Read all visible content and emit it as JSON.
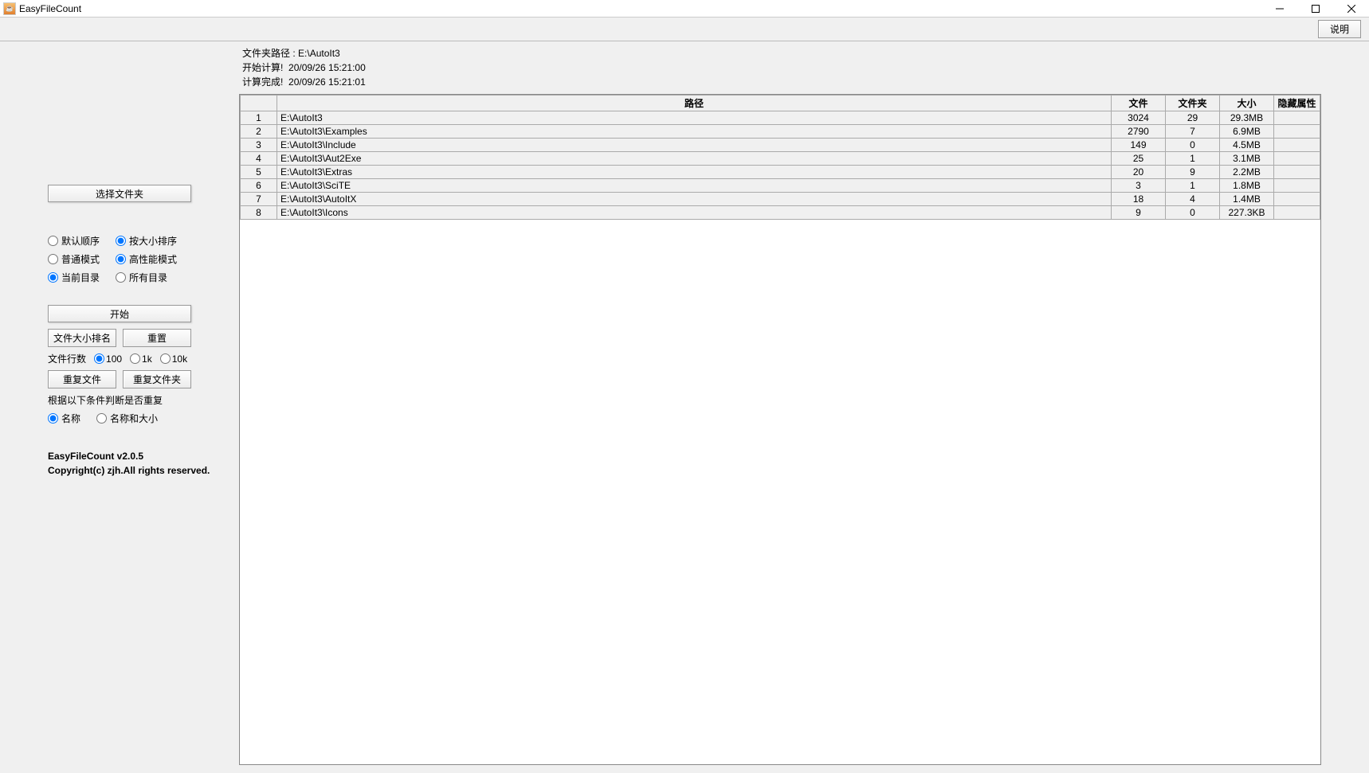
{
  "window": {
    "title": "EasyFileCount"
  },
  "topbar": {
    "help_button": "说明"
  },
  "sidebar": {
    "select_folder_button": "选择文件夹",
    "sort_group": {
      "default_order": "默认顺序",
      "size_order": "按大小排序"
    },
    "mode_group": {
      "normal": "普通模式",
      "high_perf": "高性能模式"
    },
    "dir_group": {
      "current": "当前目录",
      "all": "所有目录"
    },
    "start_button": "开始",
    "file_size_rank_button": "文件大小排名",
    "reset_button": "重置",
    "file_lines_label": "文件行数",
    "file_lines_opts": {
      "o100": "100",
      "o1k": "1k",
      "o10k": "10k"
    },
    "dup_files_button": "重复文件",
    "dup_folders_button": "重复文件夹",
    "dup_criteria_label": "根据以下条件判断是否重复",
    "dup_criteria": {
      "name": "名称",
      "name_size": "名称和大小"
    },
    "version_line": "EasyFileCount v2.0.5",
    "copyright_line": "Copyright(c) zjh.All rights reserved."
  },
  "info": {
    "path_label": "文件夹路径 :",
    "path_value": "E:\\AutoIt3",
    "start_label": "开始计算!",
    "start_time": "20/09/26 15:21:00",
    "done_label": "计算完成!",
    "done_time": "20/09/26 15:21:01"
  },
  "table": {
    "headers": {
      "rownum": "",
      "path": "路径",
      "files": "文件",
      "folders": "文件夹",
      "size": "大小",
      "hidden": "隐藏属性"
    },
    "rows": [
      {
        "n": "1",
        "path": "E:\\AutoIt3",
        "files": "3024",
        "folders": "29",
        "size": "29.3MB",
        "hidden": ""
      },
      {
        "n": "2",
        "path": "E:\\AutoIt3\\Examples",
        "files": "2790",
        "folders": "7",
        "size": "6.9MB",
        "hidden": ""
      },
      {
        "n": "3",
        "path": "E:\\AutoIt3\\Include",
        "files": "149",
        "folders": "0",
        "size": "4.5MB",
        "hidden": ""
      },
      {
        "n": "4",
        "path": "E:\\AutoIt3\\Aut2Exe",
        "files": "25",
        "folders": "1",
        "size": "3.1MB",
        "hidden": ""
      },
      {
        "n": "5",
        "path": "E:\\AutoIt3\\Extras",
        "files": "20",
        "folders": "9",
        "size": "2.2MB",
        "hidden": ""
      },
      {
        "n": "6",
        "path": "E:\\AutoIt3\\SciTE",
        "files": "3",
        "folders": "1",
        "size": "1.8MB",
        "hidden": ""
      },
      {
        "n": "7",
        "path": "E:\\AutoIt3\\AutoItX",
        "files": "18",
        "folders": "4",
        "size": "1.4MB",
        "hidden": ""
      },
      {
        "n": "8",
        "path": "E:\\AutoIt3\\Icons",
        "files": "9",
        "folders": "0",
        "size": "227.3KB",
        "hidden": ""
      }
    ]
  }
}
